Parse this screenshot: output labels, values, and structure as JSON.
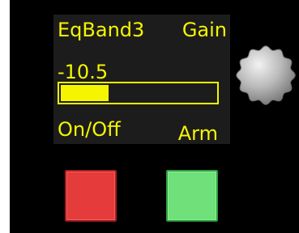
{
  "display": {
    "parameter_name": "EqBand3",
    "parameter_type": "Gain",
    "value": "-10.5",
    "level_fraction": 0.31,
    "onoff_label": "On/Off",
    "arm_label": "Arm",
    "text_color": "#f5f500",
    "background_color": "#1c1c1c"
  },
  "controls": {
    "knob_icon": "rotary-encoder-knob",
    "left_button_color": "#e63b3b",
    "right_button_color": "#6fe07a"
  }
}
